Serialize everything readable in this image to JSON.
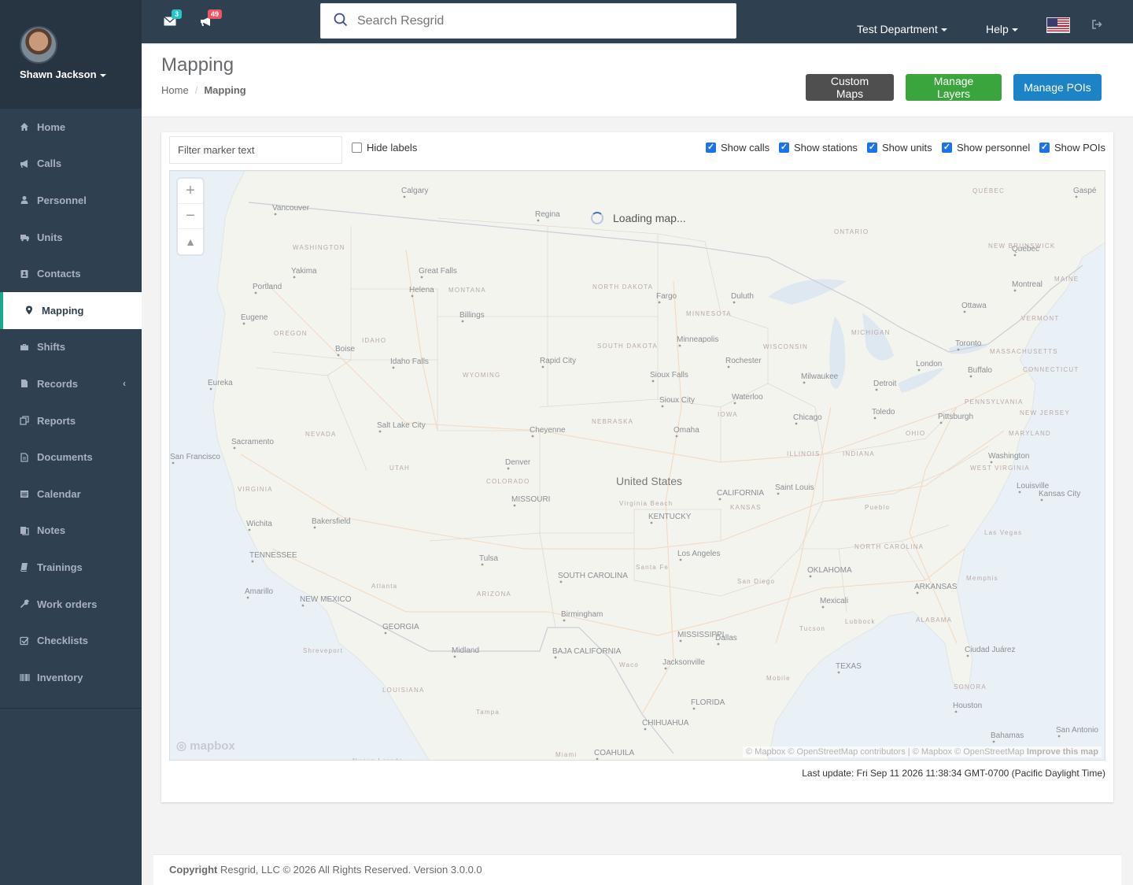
{
  "user": {
    "name": "Shawn Jackson"
  },
  "sidebar": {
    "items": [
      {
        "label": "Home",
        "icon": "home-icon"
      },
      {
        "label": "Calls",
        "icon": "bullhorn-icon"
      },
      {
        "label": "Personnel",
        "icon": "user-icon"
      },
      {
        "label": "Units",
        "icon": "truck-icon"
      },
      {
        "label": "Contacts",
        "icon": "address-book-icon"
      },
      {
        "label": "Mapping",
        "icon": "map-marker-icon",
        "active": true
      },
      {
        "label": "Shifts",
        "icon": "briefcase-icon"
      },
      {
        "label": "Records",
        "icon": "file-icon"
      },
      {
        "label": "Reports",
        "icon": "copy-icon"
      },
      {
        "label": "Documents",
        "icon": "file-text-icon"
      },
      {
        "label": "Calendar",
        "icon": "calendar-icon"
      },
      {
        "label": "Notes",
        "icon": "notes-icon"
      },
      {
        "label": "Trainings",
        "icon": "book-icon"
      },
      {
        "label": "Work orders",
        "icon": "wrench-icon"
      },
      {
        "label": "Checklists",
        "icon": "check-square-icon"
      },
      {
        "label": "Inventory",
        "icon": "barcode-icon"
      }
    ]
  },
  "topbar": {
    "messages_count": "3",
    "notifications_count": "49",
    "search_placeholder": "Search Resgrid",
    "department": "Test Department",
    "help": "Help",
    "colors": {
      "bar": "#2f4050",
      "messages_badge": "#23c6c8",
      "notifications_badge": "#ed5565"
    }
  },
  "header": {
    "title": "Mapping",
    "breadcrumb": [
      "Home",
      "Mapping"
    ],
    "buttons": {
      "custom_maps": "Custom Maps",
      "manage_layers": "Manage Layers",
      "manage_pois": "Manage POIs"
    }
  },
  "map_controls": {
    "filter_placeholder": "Filter marker text",
    "hide_labels": "Hide labels",
    "show_calls": "Show calls",
    "show_stations": "Show stations",
    "show_units": "Show units",
    "show_personnel": "Show personnel",
    "show_pois": "Show POIs"
  },
  "map": {
    "loading": "Loading map...",
    "logo": "mapbox",
    "attribution": "© Mapbox © OpenStreetMap contributors | © Mapbox © OpenStreetMap",
    "improve": "Improve this map",
    "labels": [
      {
        "t": "Vancouver"
      },
      {
        "t": "Calgary"
      },
      {
        "t": "Regina"
      },
      {
        "t": "QUÉBEC"
      },
      {
        "t": "Gaspé"
      },
      {
        "t": "WASHINGTON"
      },
      {
        "t": "ONTARIO"
      },
      {
        "t": "Quebec"
      },
      {
        "t": "NEW BRUNSWICK"
      },
      {
        "t": "Yakima"
      },
      {
        "t": "Great Falls"
      },
      {
        "t": "Portland"
      },
      {
        "t": "Helena"
      },
      {
        "t": "MONTANA"
      },
      {
        "t": "NORTH DAKOTA"
      },
      {
        "t": "Fargo"
      },
      {
        "t": "Duluth"
      },
      {
        "t": "Montreal"
      },
      {
        "t": "MAINE"
      },
      {
        "t": "Eugene"
      },
      {
        "t": "Billings"
      },
      {
        "t": "MINNESOTA"
      },
      {
        "t": "Ottawa"
      },
      {
        "t": "VERMONT"
      },
      {
        "t": "OREGON"
      },
      {
        "t": "MICHIGAN"
      },
      {
        "t": "Boise"
      },
      {
        "t": "IDAHO"
      },
      {
        "t": "SOUTH DAKOTA"
      },
      {
        "t": "Minneapolis"
      },
      {
        "t": "WISCONSIN"
      },
      {
        "t": "Toronto"
      },
      {
        "t": "MASSACHUSETTS"
      },
      {
        "t": "Idaho Falls"
      },
      {
        "t": "Rapid City"
      },
      {
        "t": "Rochester"
      },
      {
        "t": "London"
      },
      {
        "t": "Buffalo"
      },
      {
        "t": "CONNECTICUT"
      },
      {
        "t": "WYOMING"
      },
      {
        "t": "Sioux Falls"
      },
      {
        "t": "Milwaukee"
      },
      {
        "t": "Eureka"
      },
      {
        "t": "Detroit"
      },
      {
        "t": "Waterloo"
      },
      {
        "t": "Sioux City"
      },
      {
        "t": "PENNSYLVANIA"
      },
      {
        "t": "IOWA"
      },
      {
        "t": "Toledo"
      },
      {
        "t": "Salt Lake City"
      },
      {
        "t": "NEBRASKA"
      },
      {
        "t": "Chicago"
      },
      {
        "t": "Pittsburgh"
      },
      {
        "t": "NEW JERSEY"
      },
      {
        "t": "Cheyenne"
      },
      {
        "t": "Omaha"
      },
      {
        "t": "NEVADA"
      },
      {
        "t": "OHIO"
      },
      {
        "t": "MARYLAND"
      },
      {
        "t": "Sacramento"
      },
      {
        "t": "ILLINOIS"
      },
      {
        "t": "INDIANA"
      },
      {
        "t": "Washington"
      },
      {
        "t": "San Francisco"
      },
      {
        "t": "UTAH"
      },
      {
        "t": "Denver"
      },
      {
        "t": "WEST VIRGINIA"
      },
      {
        "t": "COLORADO"
      },
      {
        "t": "United States"
      },
      {
        "t": "Saint Louis"
      },
      {
        "t": "Louisville"
      },
      {
        "t": "VIRGINIA"
      },
      {
        "t": "CALIFORNIA"
      },
      {
        "t": "Kansas City"
      },
      {
        "t": "Virginia Beach"
      },
      {
        "t": "KANSAS"
      },
      {
        "t": "MISSOURI"
      },
      {
        "t": "Pueblo"
      },
      {
        "t": "KENTUCKY"
      },
      {
        "t": "Wichita"
      },
      {
        "t": "Bakersfield"
      },
      {
        "t": "Las Vegas"
      },
      {
        "t": "NORTH CAROLINA"
      },
      {
        "t": "TENNESSEE"
      },
      {
        "t": "Los Angeles"
      },
      {
        "t": "Tulsa"
      },
      {
        "t": "Santa Fe"
      },
      {
        "t": "OKLAHOMA"
      },
      {
        "t": "Memphis"
      },
      {
        "t": "SOUTH CAROLINA"
      },
      {
        "t": "Amarillo"
      },
      {
        "t": "San Diego"
      },
      {
        "t": "ARKANSAS"
      },
      {
        "t": "Atlanta"
      },
      {
        "t": "ARIZONA"
      },
      {
        "t": "NEW MEXICO"
      },
      {
        "t": "Mexicali"
      },
      {
        "t": "Birmingham"
      },
      {
        "t": "Lubbock"
      },
      {
        "t": "ALABAMA"
      },
      {
        "t": "GEORGIA"
      },
      {
        "t": "Tucson"
      },
      {
        "t": "MISSISSIPPI"
      },
      {
        "t": "Dallas"
      },
      {
        "t": "Shreveport"
      },
      {
        "t": "BAJA CALIFORNIA"
      },
      {
        "t": "Midland"
      },
      {
        "t": "Ciudad Juárez"
      },
      {
        "t": "Jacksonville"
      },
      {
        "t": "Waco"
      },
      {
        "t": "TEXAS"
      },
      {
        "t": "Mobile"
      },
      {
        "t": "LOUISIANA"
      },
      {
        "t": "SONORA"
      },
      {
        "t": "FLORIDA"
      },
      {
        "t": "Houston"
      },
      {
        "t": "Tampa"
      },
      {
        "t": "CHIHUAHUA"
      },
      {
        "t": "San Antonio"
      },
      {
        "t": "Bahamas"
      },
      {
        "t": "Miami"
      },
      {
        "t": "COAHUILA"
      },
      {
        "t": "Nuevo Laredo"
      },
      {
        "t": "BAJA CALIFORNIA"
      }
    ]
  },
  "last_update": "Last update: Fri Sep 11 2026 11:38:34 GMT-0700 (Pacific Daylight Time)",
  "footer": {
    "copyright_label": "Copyright",
    "text": "Resgrid, LLC © 2026 All Rights Reserved.",
    "version": "Version 3.0.0.0"
  }
}
